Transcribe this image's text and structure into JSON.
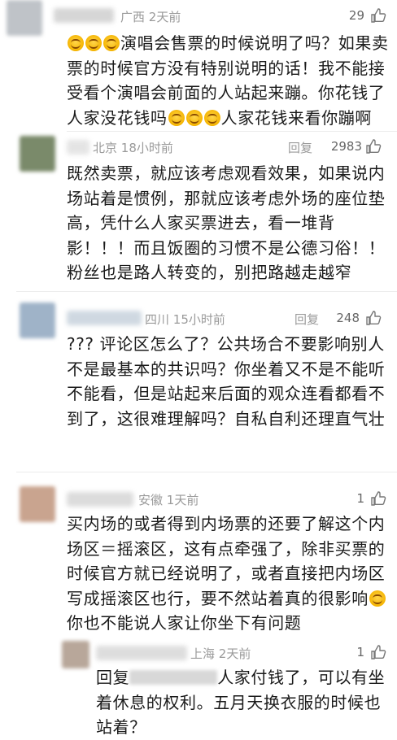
{
  "comments": [
    {
      "location": "广西",
      "time": "2天前",
      "likes": "29",
      "text_parts": [
        "演唱会售票的时候说明了吗？如果卖票的时候官方没有特别说明的话！我不能接受看个演唱会前面的人站起来蹦。你花钱了人家没花钱吗",
        "人家花钱来看你蹦啊"
      ],
      "colors": {
        "avatar": "#bfc3c8",
        "name": "#c9c9c9"
      }
    },
    {
      "location": "北京",
      "time": "18小时前",
      "reply_label": "回复",
      "likes": "2983",
      "text": "既然卖票，就应该考虑观看效果，如果说内场站着是惯例，那就应该考虑外场的座位垫高，凭什么人家买票进去，看一堆背影！！！而且饭圈的习惯不是公德习俗！！粉丝也是路人转变的，别把路越走越窄",
      "colors": {
        "avatar": "#7a8a6a",
        "name": "#d6d6d6"
      }
    },
    {
      "location": "四川",
      "time": "15小时前",
      "reply_label": "回复",
      "likes": "248",
      "text": "??? 评论区怎么了？公共场合不要影响别人不是最基本的共识吗？你坐着又不是不能听不能看，但是站起来后面的观众连看都看不到了，这很难理解吗？自私自利还理直气壮",
      "colors": {
        "avatar": "#9fb3c8",
        "name": "#c7d2dc"
      }
    },
    {
      "location": "安徽",
      "time": "1天前",
      "likes": "1",
      "text_parts": [
        "买内场的或者得到内场票的还要了解这个内场区＝摇滚区，这有点牵强了，除非买票的时候官方就已经说明了，或者直接把内场区写成摇滚区也行，要不然站着真的很影响",
        "你也不能说人家让你坐下有问题"
      ],
      "colors": {
        "avatar": "#c9a48f",
        "name": "#d2d2d2"
      }
    },
    {
      "location": "上海",
      "time": "2天前",
      "likes": "1",
      "reply_prefix": "回复",
      "text_after_mask": "人家付钱了，可以有坐着休息的权利。五月天换衣服的时候也站着？",
      "colors": {
        "avatar": "#b8a79a",
        "name": "#d0d0d0"
      }
    }
  ],
  "icons": [
    "laugh-emoji-icon",
    "thumbs-up-icon"
  ]
}
